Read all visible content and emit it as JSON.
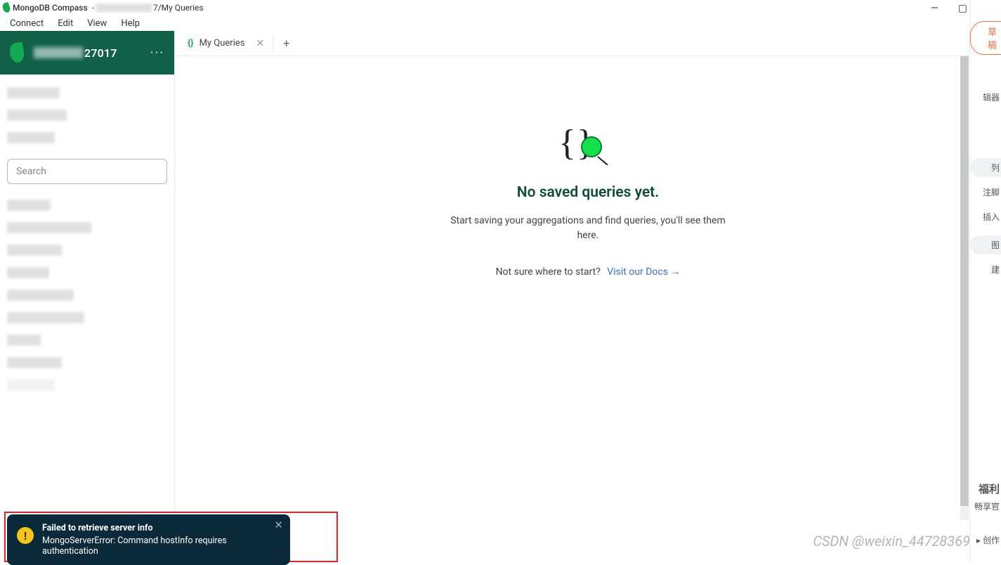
{
  "titlebar": {
    "app": "MongoDB Compass",
    "path_suffix": "7/My Queries"
  },
  "menubar": [
    "Connect",
    "Edit",
    "View",
    "Help"
  ],
  "sidebar": {
    "connection_suffix": "27017",
    "search_placeholder": "Search"
  },
  "tabs": [
    {
      "icon_label": "{}",
      "label": "My Queries"
    }
  ],
  "empty": {
    "title": "No saved queries yet.",
    "subtitle": "Start saving your aggregations and find queries, you'll see them here.",
    "help_prefix": "Not sure where to start?",
    "help_link": "Visit our Docs →"
  },
  "toast": {
    "title": "Failed to retrieve server info",
    "message": "MongoServerError: Command hostInfo requires authentication"
  },
  "right_panel": {
    "draft": "草稿",
    "t1": "辑器",
    "t2": "列",
    "t3": "注脚",
    "t4": "插入",
    "t5": "图",
    "t6": "建",
    "t7": "福利",
    "t8": "畅享官",
    "t9": "▸ 创作"
  },
  "watermark": "CSDN @weixin_44728369"
}
